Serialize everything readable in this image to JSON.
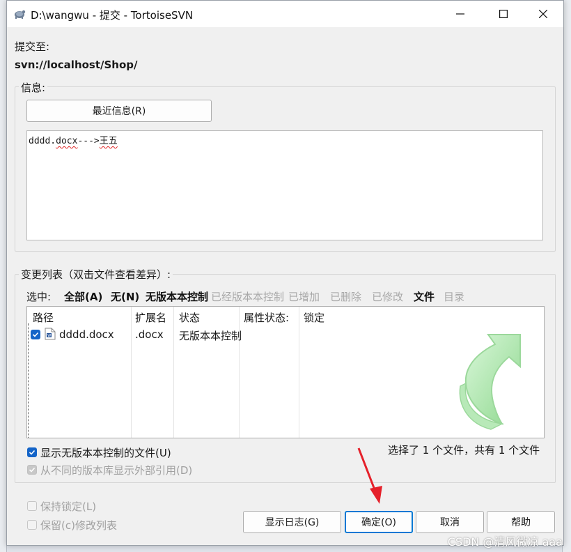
{
  "window": {
    "title": "D:\\wangwu - 提交 - TortoiseSVN"
  },
  "commit_to": {
    "label": "提交至:",
    "url": "svn://localhost/Shop/"
  },
  "message_group": {
    "title": "信息:",
    "recent_button": "最近信息(R)",
    "text_prefix": "dddd.",
    "text_docx": "docx",
    "text_arrow": "--->",
    "text_name": "王五"
  },
  "changes_group": {
    "title": "变更列表（双击文件查看差异）:",
    "select_label": "选中:",
    "filters": [
      {
        "label": "全部(A)",
        "enabled": true
      },
      {
        "label": "无(N)",
        "enabled": true
      },
      {
        "label": "无版本本控制",
        "enabled": true
      },
      {
        "label": "已经版本本控制",
        "enabled": false
      },
      {
        "label": "已增加",
        "enabled": false
      },
      {
        "label": "已删除",
        "enabled": false
      },
      {
        "label": "已修改",
        "enabled": false
      },
      {
        "label": "文件",
        "enabled": true
      },
      {
        "label": "目录",
        "enabled": false
      }
    ],
    "columns": [
      "路径",
      "扩展名",
      "状态",
      "属性状态:",
      "锁定"
    ],
    "rows": [
      {
        "checked": true,
        "path": "dddd.docx",
        "ext": ".docx",
        "status": "无版本本控制",
        "prop_status": "",
        "lock": ""
      }
    ],
    "show_unversioned": {
      "label": "显示无版本本控制的文件(U)",
      "checked": true
    },
    "show_externals": {
      "label": "从不同的版本库显示外部引用(D)",
      "checked": true,
      "disabled": true
    },
    "summary": "选择了 1 个文件，共有 1 个文件"
  },
  "bottom": {
    "keep_locks": {
      "label": "保持锁定(L)",
      "checked": false,
      "disabled": true
    },
    "keep_changelists": {
      "label": "保留(c)修改列表",
      "checked": false,
      "disabled": true
    },
    "buttons": {
      "show_log": "显示日志(G)",
      "ok": "确定(O)",
      "cancel": "取消",
      "help": "帮助"
    }
  },
  "watermark": "CSDN @清风微凉 aaa",
  "colors": {
    "accent": "#1464c8",
    "annotation_arrow": "#e5202a",
    "logo_arrow": "#9be39b"
  },
  "icons": {
    "app": "tortoise-icon",
    "file": "word-document-icon",
    "logo": "green-commit-arrow-icon"
  }
}
